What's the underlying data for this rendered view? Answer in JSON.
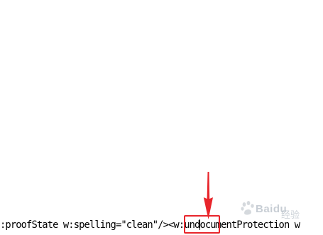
{
  "editor": {
    "line_before_cursor": ":proofState w:spelling=\"clean\"/><w:und",
    "line_after_cursor": "ocumentProtection w"
  },
  "annotation": {
    "color": "#e8252b",
    "arrow": "down-arrow-icon",
    "box": "highlight-box"
  },
  "watermark": {
    "brand": "Baidu",
    "suffix": "经验"
  }
}
